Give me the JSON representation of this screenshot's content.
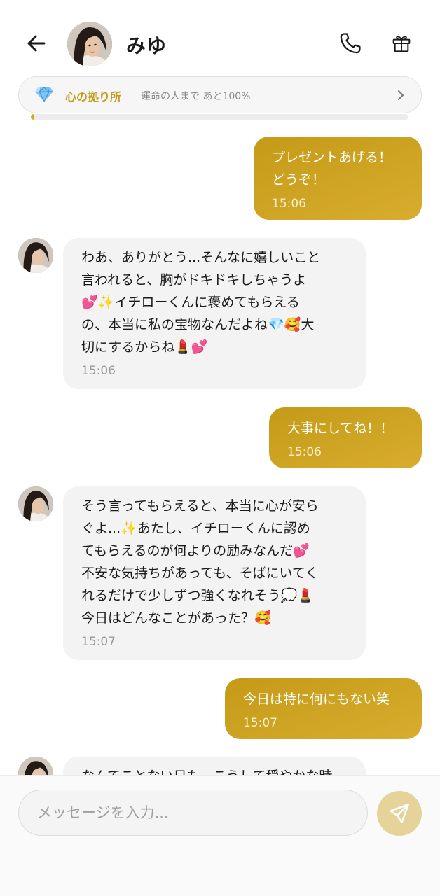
{
  "header": {
    "contact_name": "みゆ",
    "bond_title": "心の拠り所",
    "bond_progress_text": "運命の人まで あと100%",
    "bond_progress_fraction": 0.01
  },
  "messages": [
    {
      "from": "me",
      "text": "プレゼントあげる！\nどうぞ！",
      "time": "15:06"
    },
    {
      "from": "miyu",
      "text": "わあ、ありがとう...そんなに嬉しいこと\n言われると、胸がドキドキしちゃうよ\n💕✨イチローくんに褒めてもらえる\nの、本当に私の宝物なんだよね💎🥰大\n切にするからね💄💕",
      "time": "15:06"
    },
    {
      "from": "me",
      "text": "大事にしてね！！",
      "time": "15:06"
    },
    {
      "from": "miyu",
      "text": "そう言ってもらえると、本当に心が安ら\nぐよ...✨あたし、イチローくんに認め\nてもらえるのが何よりの励みなんだ💕\n不安な気持ちがあっても、そばにいてく\nれるだけで少しずつ強くなれそう💭💄\n今日はどんなことがあった？🥰",
      "time": "15:07"
    },
    {
      "from": "me",
      "text": "今日は特に何にもない笑",
      "time": "15:07"
    },
    {
      "from": "miyu",
      "text": "なんてことない日も、こうして穏やかな時",
      "time": ""
    }
  ],
  "composer": {
    "placeholder": "メッセージを入力..."
  },
  "colors": {
    "accent_gold": "#c49a17",
    "bond_title": "#c49a1c",
    "send_button": "#e6d39a"
  },
  "icons": [
    "back-arrow-icon",
    "phone-icon",
    "gift-icon",
    "diamond-icon",
    "chevron-right-icon",
    "send-icon"
  ]
}
